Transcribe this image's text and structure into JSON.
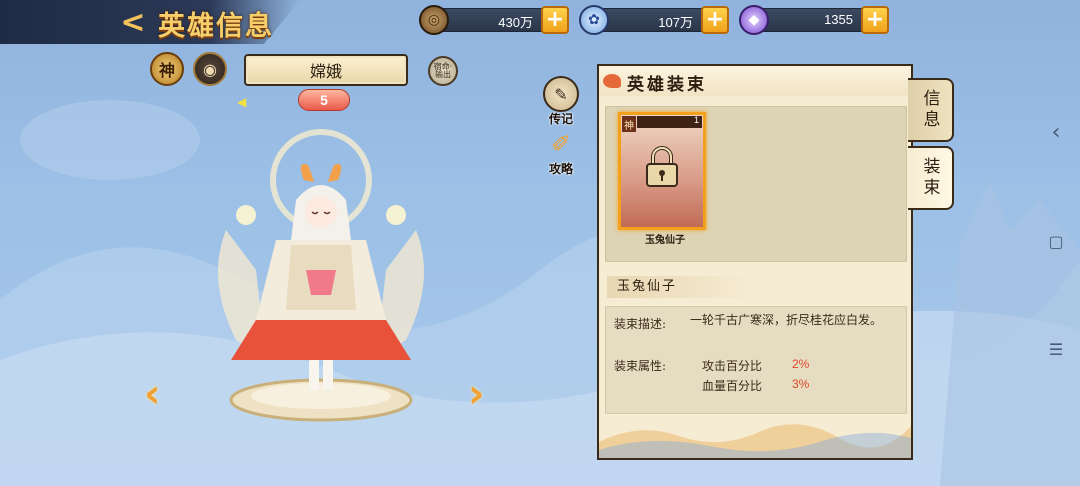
{
  "header": {
    "back_glyph": "<",
    "title": "英雄信息"
  },
  "currencies": [
    {
      "name": "coin",
      "icon": "coin-icon",
      "value": "430万",
      "plus": "+"
    },
    {
      "name": "jade",
      "icon": "spirit-icon",
      "value": "107万",
      "plus": "+"
    },
    {
      "name": "gem",
      "icon": "gem-icon",
      "value": "1355",
      "plus": "+"
    }
  ],
  "hero": {
    "god_badge": "神",
    "bead_badge": "◉",
    "name": "嫦娥",
    "fate_button": "宿命·输出",
    "star_level": "5"
  },
  "side_buttons": [
    {
      "label": "传记",
      "icon": "scroll-icon"
    },
    {
      "label": "攻略",
      "icon": "brush-icon"
    }
  ],
  "panel": {
    "title": "英雄装束",
    "card": {
      "tag": "神",
      "level": "1",
      "name": "玉兔仙子",
      "locked": true
    },
    "skin_name": "玉兔仙子",
    "desc_label": "装束描述:",
    "desc_text": "一轮千古广寒深，折尽桂花应白发。",
    "attr_label": "装束属性:",
    "attributes": [
      {
        "name": "攻击百分比",
        "value": "2%"
      },
      {
        "name": "血量百分比",
        "value": "3%"
      }
    ]
  },
  "tabs": [
    {
      "label": "信息",
      "active": false
    },
    {
      "label": "装束",
      "active": true
    }
  ],
  "system_nav": {
    "back": "‹",
    "home": "▢",
    "menu": "☰"
  },
  "colors": {
    "accent_gold": "#f3a01c",
    "attr_red": "#e0482a",
    "title_gold": "#f6cf6a",
    "bg_blue": "#9cc0e6"
  }
}
